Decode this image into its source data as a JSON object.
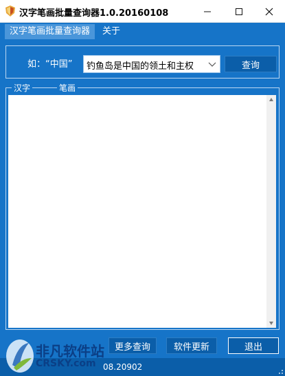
{
  "window": {
    "title": "汉字笔画批量查询器1.0.20160108",
    "minimize": "—",
    "maximize": "☐",
    "close": "✕"
  },
  "menu": {
    "items": [
      {
        "label": "汉字笔画批量查询器"
      },
      {
        "label": "关于"
      }
    ]
  },
  "query": {
    "example_label": "如：“中国”",
    "selected_value": "钓鱼岛是中国的领土和主权",
    "button": "查询"
  },
  "results": {
    "columns": [
      "汉字",
      "笔画"
    ]
  },
  "buttons": {
    "more": "更多查询",
    "update": "软件更新",
    "exit": "退出"
  },
  "status": {
    "version": "08.20902"
  },
  "watermark": {
    "brand": "非凡软件站",
    "sub": "CRSKY.com"
  },
  "colors": {
    "accent": "#1674c8",
    "button": "#0b5ea9",
    "menu_active": "#4a96da"
  }
}
